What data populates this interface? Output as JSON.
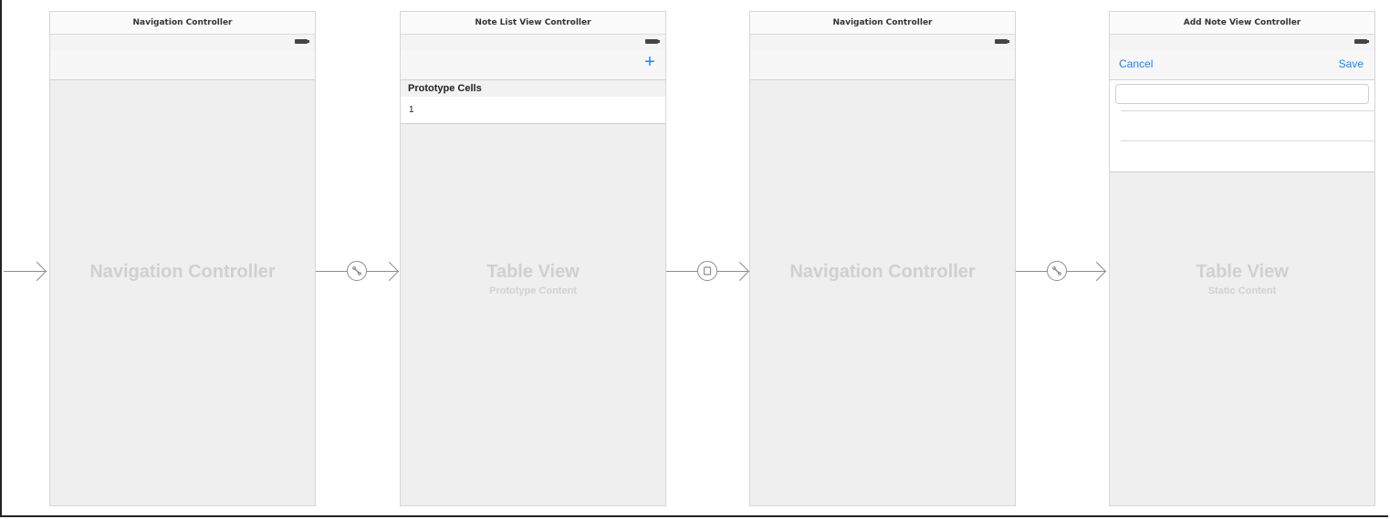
{
  "scenes": [
    {
      "title": "Navigation Controller",
      "center_label": "Navigation Controller"
    },
    {
      "title": "Note List View Controller",
      "center_label": "Table View",
      "sub_label": "Prototype Content",
      "add_symbol": "+",
      "section_header": "Prototype Cells",
      "cell_text": "1"
    },
    {
      "title": "Navigation Controller",
      "center_label": "Navigation Controller"
    },
    {
      "title": "Add Note View Controller",
      "center_label": "Table View",
      "sub_label": "Static Content",
      "cancel_label": "Cancel",
      "save_label": "Save"
    }
  ],
  "segues": [
    {
      "kind": "entry-point"
    },
    {
      "kind": "relationship-root",
      "icon": "link-icon"
    },
    {
      "kind": "present-modally",
      "icon": "modal-square-icon"
    },
    {
      "kind": "relationship-root",
      "icon": "link-icon"
    }
  ],
  "colors": {
    "accent": "#1a82fb",
    "canvas_bg": "#efefef",
    "placeholder_text": "#d0d0d0"
  }
}
